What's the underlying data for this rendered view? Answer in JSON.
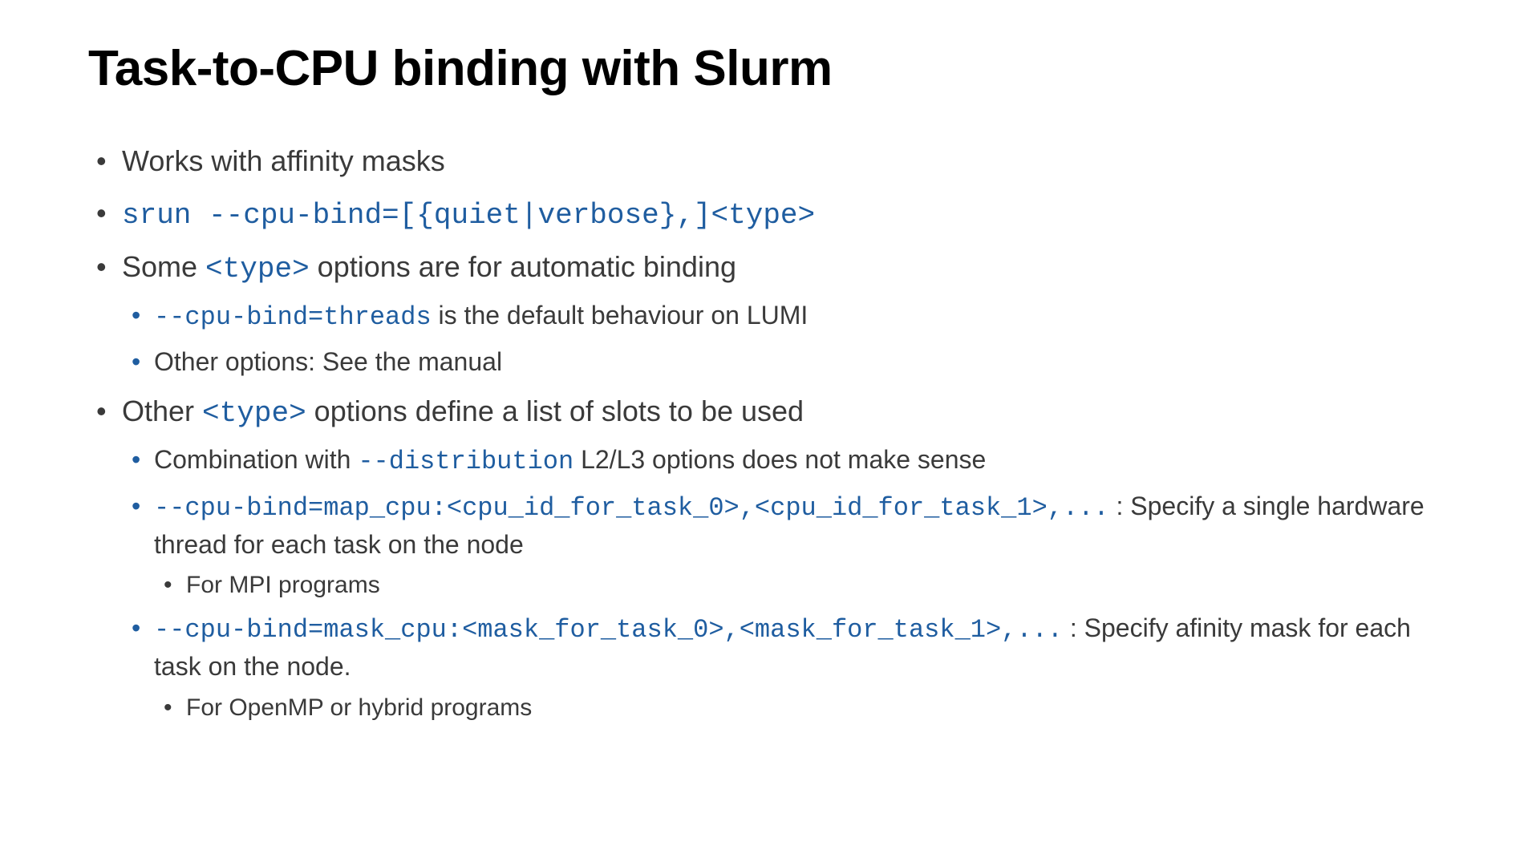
{
  "title": "Task-to-CPU binding with Slurm",
  "b1": "Works with affinity masks",
  "b2_code": "srun --cpu-bind=[{quiet|verbose},]<type>",
  "b3_pre": "Some ",
  "b3_code": "<type>",
  "b3_post": " options are for automatic binding",
  "b3a_code": "--cpu-bind=threads",
  "b3a_post": " is the default behaviour on LUMI",
  "b3b": "Other options: See the manual",
  "b4_pre": "Other ",
  "b4_code": "<type>",
  "b4_post": " options define a list of slots to be used",
  "b4a_pre": "Combination with ",
  "b4a_code": "--distribution",
  "b4a_post": " L2/L3 options does not make sense",
  "b4b_code": "--cpu-bind=map_cpu:<cpu_id_for_task_0>,<cpu_id_for_task_1>,...",
  "b4b_post": " : Specify a single hardware thread for each task on the node",
  "b4b_i": "For MPI programs",
  "b4c_code": "--cpu-bind=mask_cpu:<mask_for_task_0>,<mask_for_task_1>,...",
  "b4c_post": " : Specify afinity mask for each task on the node.",
  "b4c_i": "For OpenMP or hybrid programs"
}
